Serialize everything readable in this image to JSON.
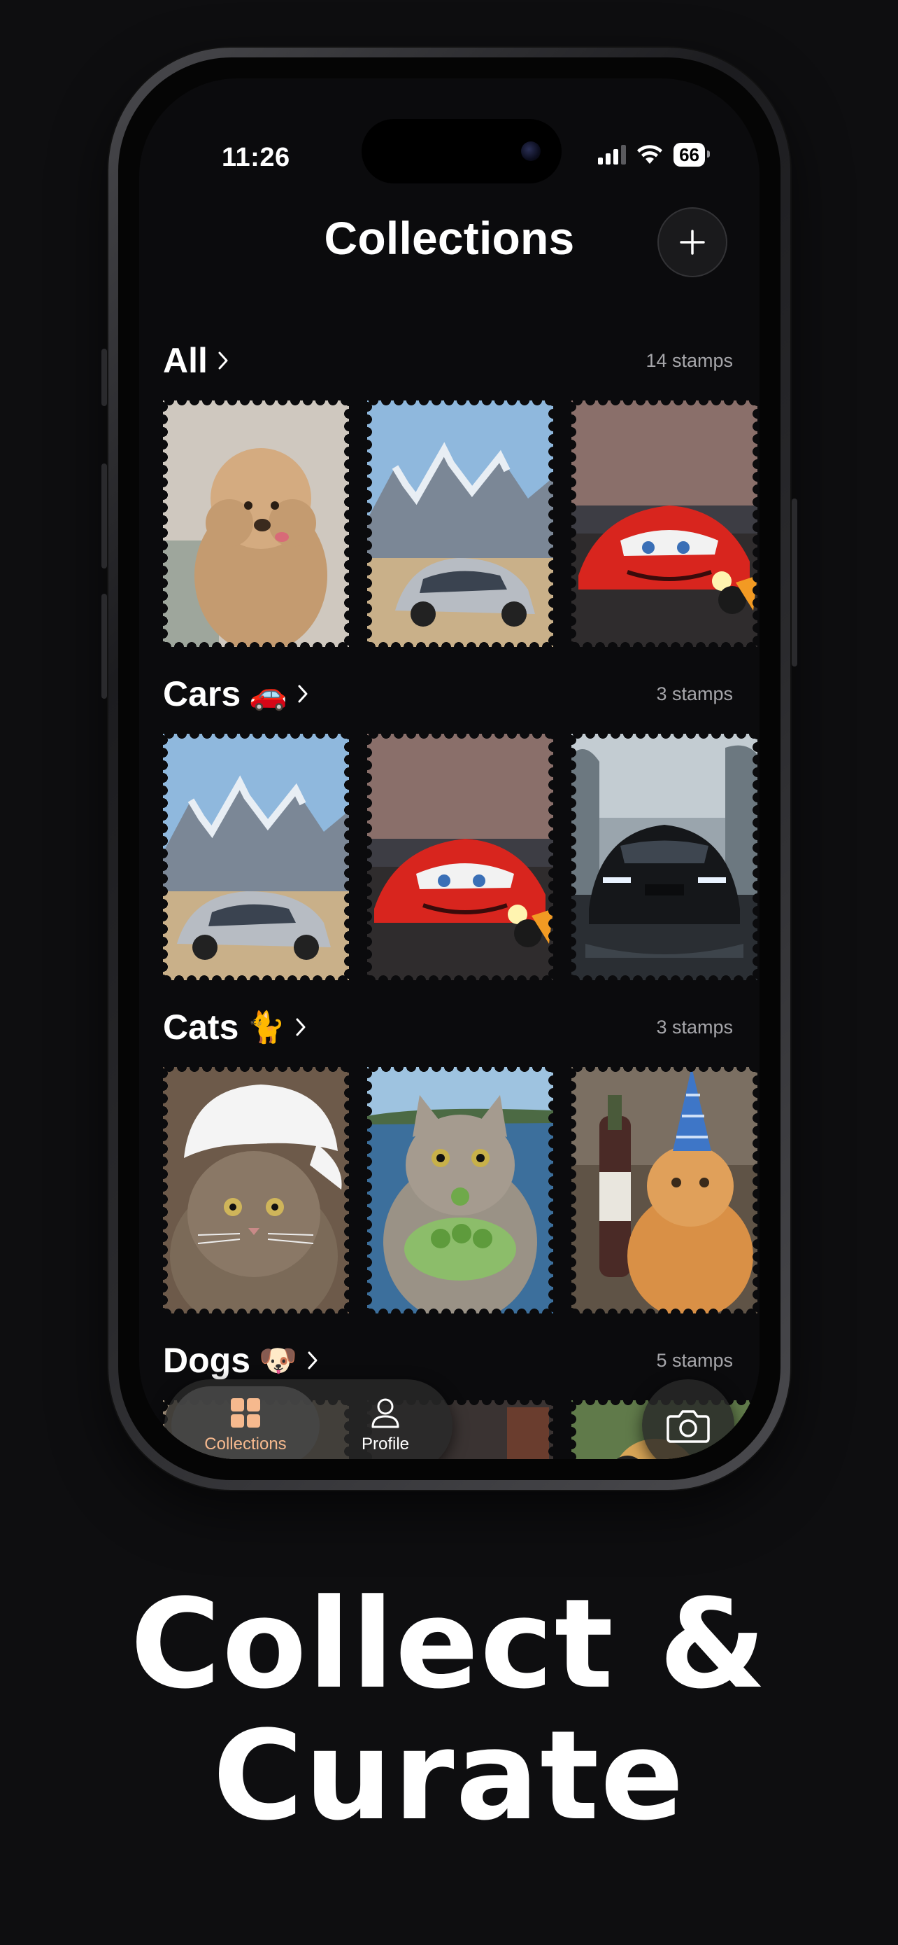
{
  "status_bar": {
    "time": "11:26",
    "battery": "66"
  },
  "header": {
    "title": "Collections"
  },
  "sections": [
    {
      "title": "All",
      "emoji": "",
      "count": "14 stamps",
      "stamps": [
        "poodle",
        "silver-car-mountains",
        "red-race-car",
        "partial"
      ]
    },
    {
      "title": "Cars",
      "emoji": "🚗",
      "count": "3 stamps",
      "stamps": [
        "silver-car-mountains",
        "red-race-car",
        "black-sports-car"
      ]
    },
    {
      "title": "Cats",
      "emoji": "🐈",
      "count": "3 stamps",
      "stamps": [
        "cat-cap",
        "cat-cucumber",
        "cat-party-hat"
      ]
    },
    {
      "title": "Dogs",
      "emoji": "🐶",
      "count": "5 stamps",
      "stamps": [
        "dog-1",
        "dog-2",
        "dog-3",
        "partial"
      ]
    }
  ],
  "tabbar": {
    "collections_label": "Collections",
    "profile_label": "Profile"
  },
  "tagline": {
    "line1": "Collect &",
    "line2": "Curate"
  },
  "colors": {
    "active_tab": "#f6b98e",
    "background": "#0e0e10"
  }
}
